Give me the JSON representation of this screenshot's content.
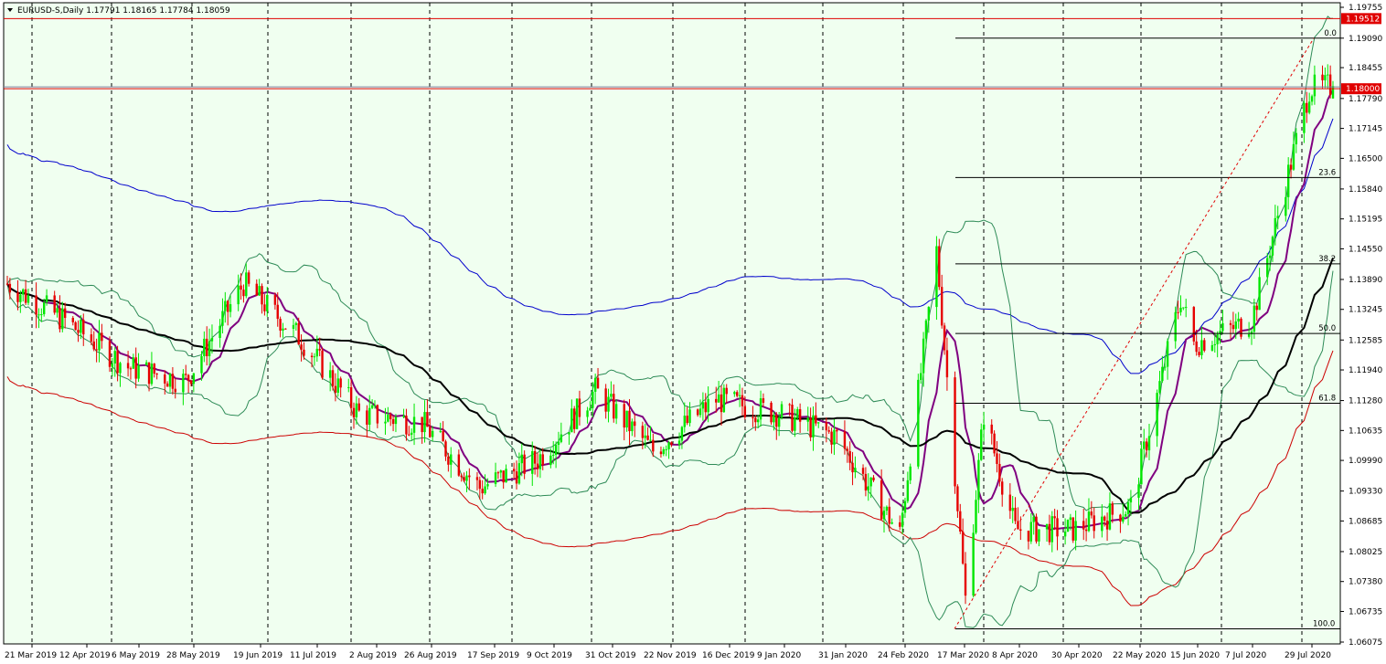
{
  "window": {
    "symbol_title": "EURUSD-S,Daily",
    "ohlc": "1.17791 1.18165 1.17784 1.18059"
  },
  "colors": {
    "background": "#f0fff0",
    "grid": "#000000",
    "candle_up": "#00e600",
    "candle_down": "#e60000",
    "price_line": "#e00000",
    "ma_black": "#000000",
    "ma_purple": "#800080",
    "bb_green": "#2e8b57",
    "env_blue": "#0000cc",
    "env_red": "#cc0000",
    "fib": "#000000",
    "trend": "#e00000"
  },
  "price_axis": {
    "ticks": [
      "1.19755",
      "1.19090",
      "1.18455",
      "1.17790",
      "1.17145",
      "1.16500",
      "1.15840",
      "1.15195",
      "1.14550",
      "1.13890",
      "1.13245",
      "1.12585",
      "1.11940",
      "1.11280",
      "1.10635",
      "1.09990",
      "1.09330",
      "1.08685",
      "1.08025",
      "1.07380",
      "1.06735",
      "1.06075"
    ],
    "high_label": "1.19512",
    "current_label": "1.18000"
  },
  "time_axis": {
    "labels": [
      "21 Mar 2019",
      "12 Apr 2019",
      "6 May 2019",
      "28 May 2019",
      "19 Jun 2019",
      "11 Jul 2019",
      "2 Aug 2019",
      "26 Aug 2019",
      "17 Sep 2019",
      "9 Oct 2019",
      "31 Oct 2019",
      "22 Nov 2019",
      "16 Dec 2019",
      "9 Jan 2020",
      "31 Jan 2020",
      "24 Feb 2020",
      "17 Mar 2020",
      "8 Apr 2020",
      "30 Apr 2020",
      "22 May 2020",
      "15 Jun 2020",
      "7 Jul 2020",
      "29 Jul 2020"
    ]
  },
  "fibonacci": {
    "levels": [
      "0.0",
      "23.6",
      "38.2",
      "50.0",
      "61.8",
      "100.0"
    ]
  },
  "chart_data": {
    "type": "candlestick",
    "symbol": "EURUSD-S",
    "timeframe": "Daily",
    "last_bar": {
      "open": 1.17791,
      "high": 1.18165,
      "low": 1.17784,
      "close": 1.18059
    },
    "ylim": [
      1.06075,
      1.19755
    ],
    "date_range": [
      "2019-03-21",
      "2020-08-07"
    ],
    "horizontal_lines": [
      1.19512,
      1.18
    ],
    "fib_retracement": {
      "high": 1.1909,
      "low": 1.0636
    },
    "ohlc_path": [
      [
        "2019-03-21",
        1.138
      ],
      [
        "2019-04-12",
        1.13
      ],
      [
        "2019-05-06",
        1.12
      ],
      [
        "2019-05-28",
        1.117
      ],
      [
        "2019-06-19",
        1.138
      ],
      [
        "2019-07-11",
        1.126
      ],
      [
        "2019-08-02",
        1.11
      ],
      [
        "2019-08-26",
        1.108
      ],
      [
        "2019-09-17",
        1.094
      ],
      [
        "2019-10-09",
        1.1
      ],
      [
        "2019-10-31",
        1.115
      ],
      [
        "2019-11-22",
        1.102
      ],
      [
        "2019-12-16",
        1.113
      ],
      [
        "2020-01-09",
        1.11
      ],
      [
        "2020-01-31",
        1.105
      ],
      [
        "2020-02-24",
        1.084
      ],
      [
        "2020-03-09",
        1.145
      ],
      [
        "2020-03-20",
        1.07
      ],
      [
        "2020-03-27",
        1.11
      ],
      [
        "2020-04-08",
        1.085
      ],
      [
        "2020-04-30",
        1.085
      ],
      [
        "2020-05-22",
        1.09
      ],
      [
        "2020-06-10",
        1.135
      ],
      [
        "2020-06-15",
        1.125
      ],
      [
        "2020-07-07",
        1.13
      ],
      [
        "2020-07-29",
        1.18
      ],
      [
        "2020-08-07",
        1.1806
      ]
    ],
    "grid": true
  }
}
